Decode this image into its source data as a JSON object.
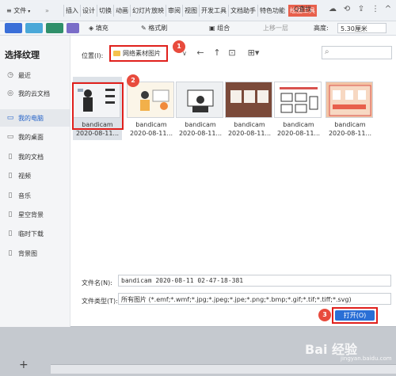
{
  "menubar": {
    "file_label": "文件",
    "more": "»",
    "tabs": [
      "插入",
      "设计",
      "切换",
      "动画",
      "幻灯片放映",
      "审阅",
      "视图",
      "开发工具",
      "文档助手",
      "特色功能",
      "绘图工具"
    ],
    "active_tab": "绘图工具",
    "search_label": "Q查找"
  },
  "toolbar": {
    "fill_label": "填充",
    "format_label": "格式刷",
    "group_label": "组合",
    "up_label": "上移一层",
    "height_label": "高度:",
    "height_value": "5.30厘米"
  },
  "dialog": {
    "title": "选择纹理",
    "sidebar": [
      {
        "icon": "clock-icon",
        "label": "最近"
      },
      {
        "icon": "cloud-icon",
        "label": "我的云文档"
      },
      {
        "icon": "computer-icon",
        "label": "我的电脑"
      },
      {
        "icon": "desktop-icon",
        "label": "我的桌面"
      },
      {
        "icon": "document-icon",
        "label": "我的文档"
      },
      {
        "icon": "video-icon",
        "label": "视频"
      },
      {
        "icon": "music-icon",
        "label": "音乐"
      },
      {
        "icon": "image-icon",
        "label": "星空背景"
      },
      {
        "icon": "folder-icon",
        "label": "临时下载"
      },
      {
        "icon": "folder-icon",
        "label": "背景图"
      }
    ],
    "active_sidebar": "我的电脑",
    "location_label": "位置(I):",
    "location_value": "网络素材图片",
    "files": [
      {
        "name": "bandicam",
        "date": "2020-08-11..."
      },
      {
        "name": "bandicam",
        "date": "2020-08-11..."
      },
      {
        "name": "bandicam",
        "date": "2020-08-11..."
      },
      {
        "name": "bandicam",
        "date": "2020-08-11..."
      },
      {
        "name": "bandicam",
        "date": "2020-08-11..."
      },
      {
        "name": "bandicam",
        "date": "2020-08-11..."
      }
    ],
    "filename_label": "文件名(N):",
    "filename_value": "bandicam 2020-08-11 02-47-18-381",
    "filetype_label": "文件类型(T):",
    "filetype_value": "所有图片 (*.emf;*.wmf;*.jpg;*.jpeg;*.jpe;*.png;*.bmp;*.gif;*.tif;*.tiff;*.svg)",
    "open_label": "打开(O)"
  },
  "badges": [
    "1",
    "2",
    "3"
  ],
  "bottom": {
    "plus": "+",
    "watermark": "Bai 经验",
    "watermark_sub": "jingyan.baidu.com"
  },
  "colors": {
    "accent_red": "#e0201c",
    "primary_blue": "#2a6fd6",
    "active_tab": "#e8604c"
  }
}
